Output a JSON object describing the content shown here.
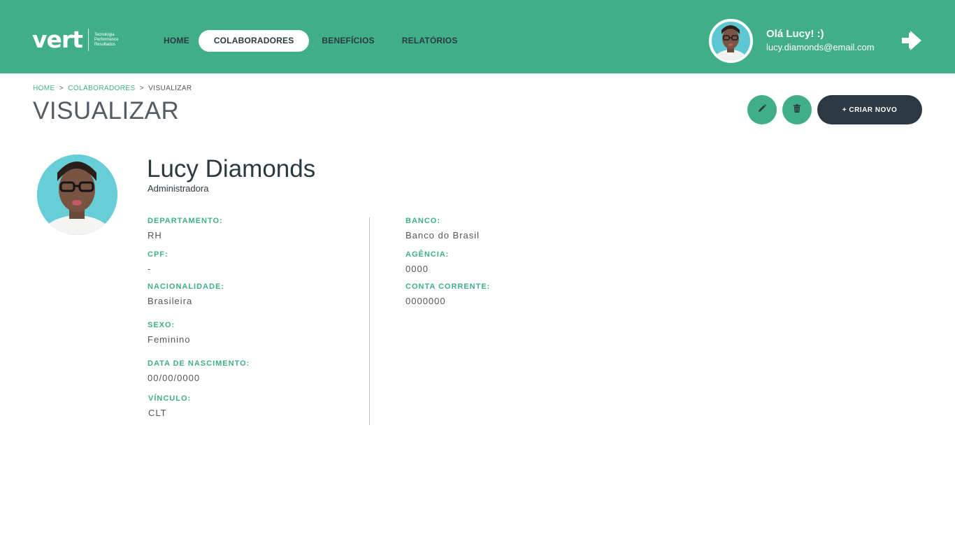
{
  "brand": {
    "logo_text": "vert",
    "tagline": [
      "Tecnologia",
      "Performance",
      "Resultados"
    ]
  },
  "nav": {
    "items": [
      {
        "label": "HOME",
        "active": false
      },
      {
        "label": "COLABORADORES",
        "active": true
      },
      {
        "label": "BENEFÍCIOS",
        "active": false
      },
      {
        "label": "RELATÓRIOS",
        "active": false
      }
    ]
  },
  "user": {
    "greeting": "Olá Lucy! :)",
    "email": "lucy.diamonds@email.com",
    "logout_icon": "arrow-right-icon"
  },
  "breadcrumb": {
    "items": [
      "HOME",
      "COLABORADORES",
      "VISUALIZAR"
    ],
    "separator": ">"
  },
  "page": {
    "title": "VISUALIZAR"
  },
  "actions": {
    "edit_icon": "pencil-icon",
    "delete_icon": "trash-icon",
    "new_label": "+ CRIAR NOVO"
  },
  "profile": {
    "name": "Lucy Diamonds",
    "role": "Administradora",
    "left_fields": [
      {
        "label": "DEPARTAMENTO:",
        "value": "RH"
      },
      {
        "label": "CPF:",
        "value": "-"
      },
      {
        "label": "NACIONALIDADE:",
        "value": "Brasileira"
      },
      {
        "label": "SEXO:",
        "value": "Feminino"
      },
      {
        "label": "DATA DE NASCIMENTO:",
        "value": "00/00/0000"
      },
      {
        "label": "VÍNCULO:",
        "value": "CLT"
      }
    ],
    "right_fields": [
      {
        "label": "BANCO:",
        "value": "Banco do Brasil"
      },
      {
        "label": "AGÊNCIA:",
        "value": "0000"
      },
      {
        "label": "CONTA CORRENTE:",
        "value": "0000000"
      }
    ]
  },
  "colors": {
    "primary": "#41ae8a",
    "dark": "#2c3942",
    "text": "#555555"
  }
}
